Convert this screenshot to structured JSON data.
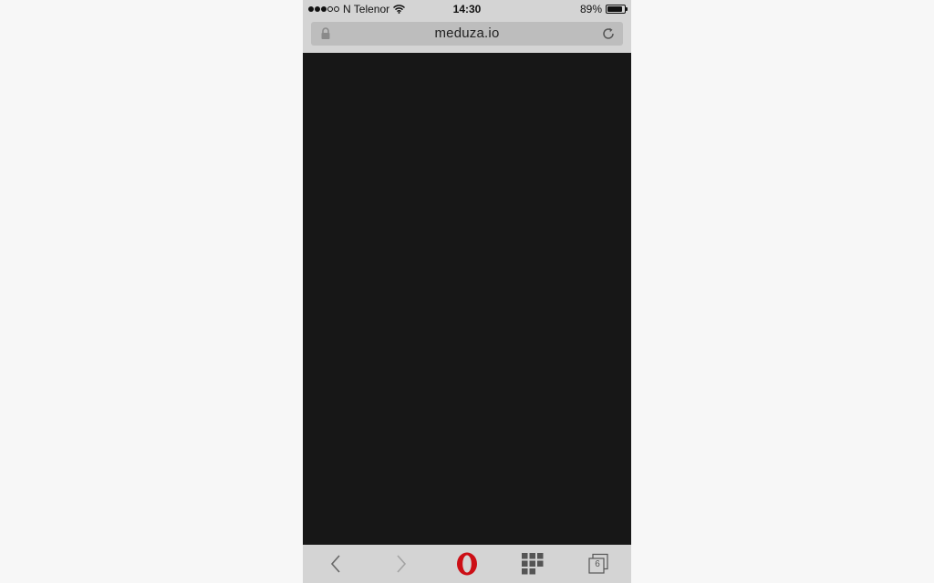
{
  "status_bar": {
    "signal_bars_filled": 3,
    "signal_bars_total": 5,
    "carrier": "N Telenor",
    "wifi_icon": "wifi-icon",
    "time": "14:30",
    "battery_percent_label": "89%",
    "battery_level": 0.89
  },
  "address_bar": {
    "lock_icon": "lock-icon",
    "url": "meduza.io",
    "reload_icon": "reload-icon"
  },
  "content": {
    "background": "#171717"
  },
  "toolbar": {
    "back_icon": "chevron-left-icon",
    "forward_icon": "chevron-right-icon",
    "opera_icon": "opera-logo-icon",
    "speed_dial_icon": "grid-icon",
    "tabs_icon": "tabs-icon",
    "tabs_count": "6",
    "accent": "#cc0f16"
  }
}
